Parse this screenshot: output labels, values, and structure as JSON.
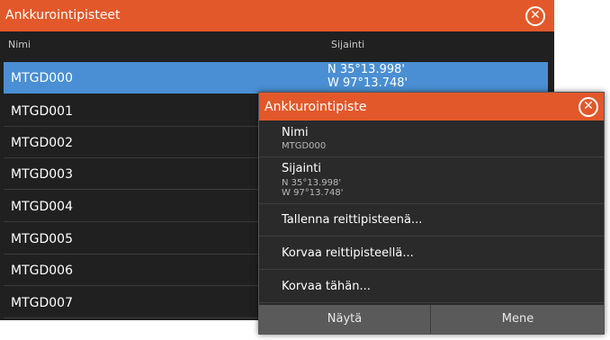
{
  "main": {
    "title": "Ankkurointipisteet",
    "columns": {
      "name": "Nimi",
      "position": "Sijainti"
    },
    "rows": [
      {
        "name": "MTGD000",
        "lat": "N  35°13.998'",
        "lon": "W  97°13.748'"
      },
      {
        "name": "MTGD001"
      },
      {
        "name": "MTGD002"
      },
      {
        "name": "MTGD003"
      },
      {
        "name": "MTGD004"
      },
      {
        "name": "MTGD005"
      },
      {
        "name": "MTGD006"
      },
      {
        "name": "MTGD007"
      }
    ]
  },
  "dialog": {
    "title": "Ankkurointipiste",
    "name_label": "Nimi",
    "name_value": "MTGD000",
    "position_label": "Sijainti",
    "lat": "N  35°13.998'",
    "lon": "W  97°13.748'",
    "actions": [
      "Tallenna reittipisteenä...",
      "Korvaa reittipisteellä...",
      "Korvaa tähän..."
    ],
    "buttons": {
      "show": "Näytä",
      "go": "Mene"
    }
  },
  "colors": {
    "title_bar": "#e2582a",
    "selection": "#4a8fd3",
    "background": "#202020"
  },
  "icons": {
    "close": "close-icon"
  }
}
